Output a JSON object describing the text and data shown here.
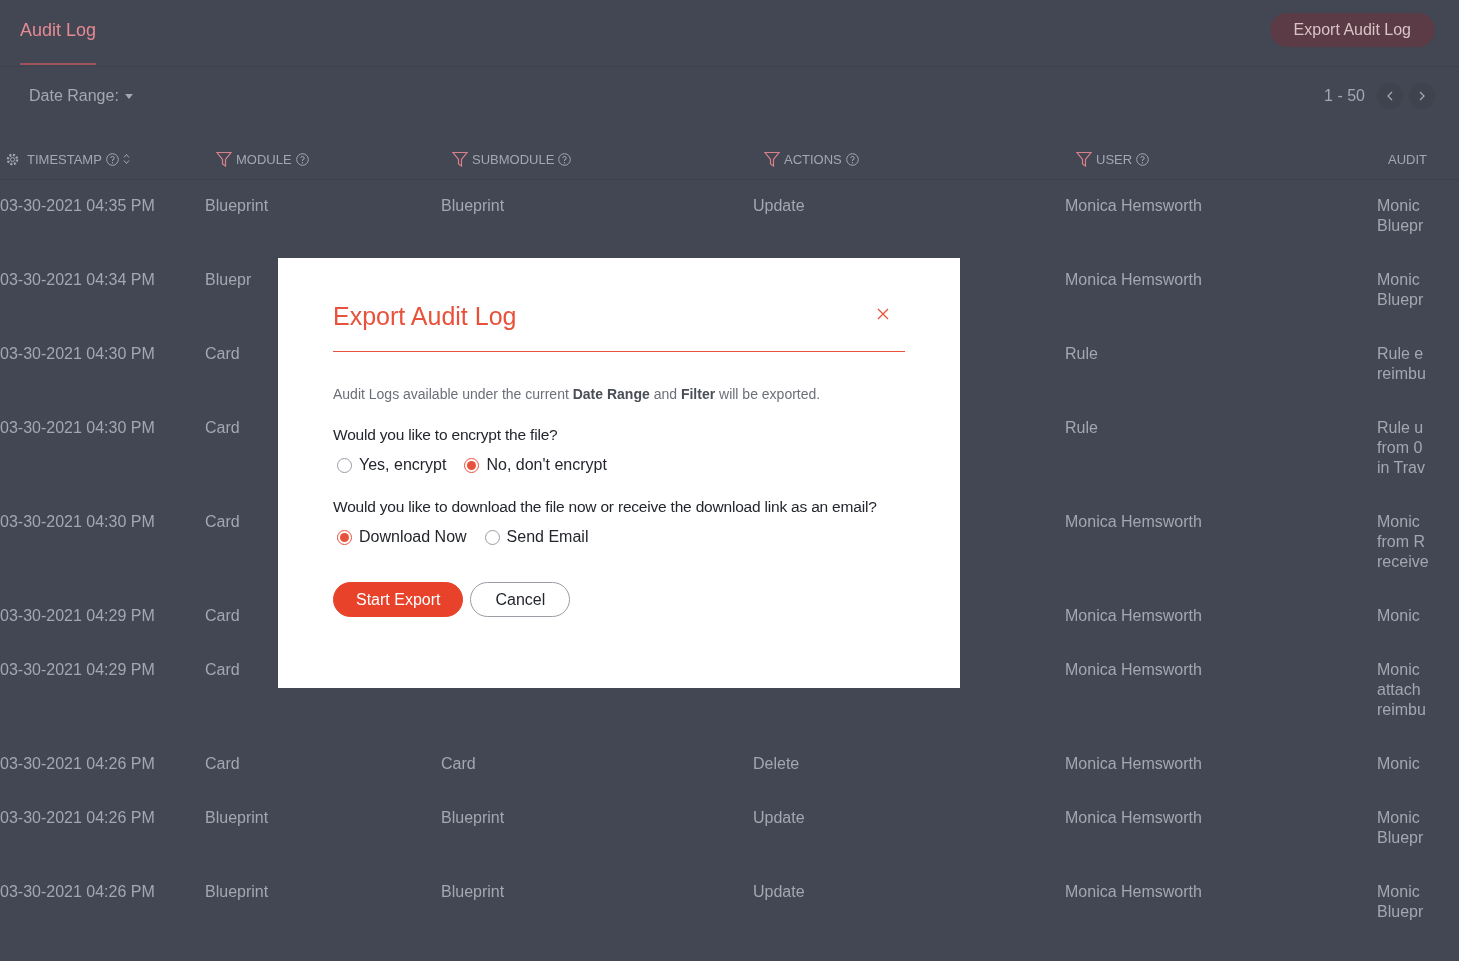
{
  "header": {
    "tab": {
      "label": "Audit Log",
      "selected": true
    },
    "export_button": "Export Audit Log"
  },
  "toolbar": {
    "date_range": "Date Range:",
    "pagination": "1 - 50"
  },
  "table": {
    "columns": [
      {
        "label": "TIMESTAMP",
        "filter": false,
        "help": true,
        "sortable": true
      },
      {
        "label": "MODULE",
        "filter": true,
        "help": true,
        "sortable": false
      },
      {
        "label": "SUBMODULE",
        "filter": true,
        "help": true,
        "sortable": false
      },
      {
        "label": "ACTIONS",
        "filter": true,
        "help": true,
        "sortable": false
      },
      {
        "label": "USER",
        "filter": true,
        "help": true,
        "sortable": false
      },
      {
        "label": "AUDIT",
        "filter": false,
        "help": false,
        "sortable": false
      }
    ],
    "rows": [
      {
        "timestamp": "03-30-2021 04:35 PM",
        "module": "Blueprint",
        "submodule": "Blueprint",
        "actions": "Update",
        "user": "Monica Hemsworth",
        "audit": [
          "Monic",
          "Bluepr"
        ]
      },
      {
        "timestamp": "03-30-2021 04:34 PM",
        "module": "Bluepr",
        "user": "Monica Hemsworth",
        "audit": [
          "Monic",
          "Bluepr"
        ]
      },
      {
        "timestamp": "03-30-2021 04:30 PM",
        "module": "Card",
        "user": "Rule",
        "audit": [
          "Rule e",
          "reimbu"
        ]
      },
      {
        "timestamp": "03-30-2021 04:30 PM",
        "module": "Card",
        "user": "Rule",
        "audit": [
          "Rule u",
          "from 0",
          "in Trav"
        ]
      },
      {
        "timestamp": "03-30-2021 04:30 PM",
        "module": "Card",
        "user": "Monica Hemsworth",
        "audit": [
          "Monic",
          "from R",
          "receive"
        ]
      },
      {
        "timestamp": "03-30-2021 04:29 PM",
        "module": "Card",
        "user": "Monica Hemsworth",
        "audit": [
          "Monic"
        ]
      },
      {
        "timestamp": "03-30-2021 04:29 PM",
        "module": "Card",
        "user": "Monica Hemsworth",
        "audit": [
          "Monic",
          "attach",
          "reimbu"
        ]
      },
      {
        "timestamp": "03-30-2021 04:26 PM",
        "module": "Card",
        "submodule": "Card",
        "actions": "Delete",
        "user": "Monica Hemsworth",
        "audit": [
          "Monic"
        ]
      },
      {
        "timestamp": "03-30-2021 04:26 PM",
        "module": "Blueprint",
        "submodule": "Blueprint",
        "actions": "Update",
        "user": "Monica Hemsworth",
        "audit": [
          "Monic",
          "Bluepr"
        ]
      },
      {
        "timestamp": "03-30-2021 04:26 PM",
        "module": "Blueprint",
        "submodule": "Blueprint",
        "actions": "Update",
        "user": "Monica Hemsworth",
        "audit": [
          "Monic",
          "Bluepr"
        ]
      }
    ]
  },
  "modal": {
    "title": "Export Audit Log",
    "description": "Audit Logs available under the current **Date Range** and **Filter** will be exported.",
    "questions": [
      {
        "text": "Would you like to encrypt the file?",
        "options": [
          {
            "label": "Yes, encrypt",
            "selected": false
          },
          {
            "label": "No, don't encrypt",
            "selected": true
          }
        ]
      },
      {
        "text": "Would you like to download the file now or receive the download link as an email?",
        "options": [
          {
            "label": "Download Now",
            "selected": true
          },
          {
            "label": "Send Email",
            "selected": false
          }
        ]
      }
    ],
    "buttons": [
      {
        "label": "Start Export",
        "kind": "primary"
      },
      {
        "label": "Cancel",
        "kind": "secondary"
      }
    ]
  }
}
